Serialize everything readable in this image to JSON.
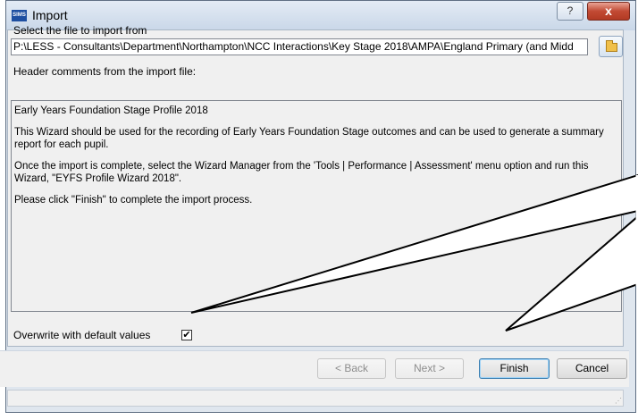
{
  "window": {
    "app_icon_text": "SIMS",
    "title": "Import",
    "help_label": "?",
    "close_label": "x"
  },
  "file_select": {
    "label": "Select the file to import from",
    "path": "P:\\LESS - Consultants\\Department\\Northampton\\NCC Interactions\\Key Stage 2018\\AMPA\\England Primary (and Midd"
  },
  "header_comments": {
    "label": "Header comments from the import file:",
    "paragraphs": [
      "Early Years Foundation Stage Profile 2018",
      "This Wizard should be used for the recording of Early Years Foundation Stage outcomes and can be used to generate a summary report for each pupil.",
      "Once the import is complete, select the Wizard Manager from the 'Tools | Performance | Assessment' menu option and run this Wizard, \"EYFS Profile Wizard 2018\".",
      "Please click \"Finish\" to complete the import process."
    ]
  },
  "overwrite": {
    "label": "Overwrite with default values",
    "checked": true,
    "check_glyph": "✔"
  },
  "buttons": {
    "back": "< Back",
    "next": "Next >",
    "finish": "Finish",
    "cancel": "Cancel"
  },
  "icons": {
    "browse": "folder-icon",
    "resize": "resize-grip-icon"
  },
  "colors": {
    "close_button": "#c24a34",
    "title_bar": "#c9d7e8",
    "sims_icon": "#1e4fa1"
  }
}
